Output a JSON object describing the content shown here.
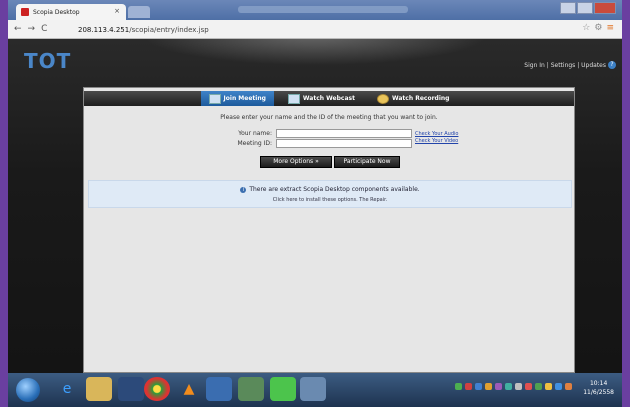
{
  "browser": {
    "tab_title": "Scopia Desktop",
    "tab_close": "×",
    "url_host": "208.113.4.251",
    "url_path": "/scopia/entry/index.jsp",
    "back": "←",
    "forward": "→",
    "reload": "C"
  },
  "page": {
    "logo": "TOT",
    "top_links": "Sign In | Settings | Updates",
    "help_icon": "?",
    "tabs": [
      {
        "label": "Join Meeting",
        "active": true
      },
      {
        "label": "Watch Webcast",
        "active": false
      },
      {
        "label": "Watch Recording",
        "active": false
      }
    ],
    "instruction": "Please enter your name and the ID of the meeting that you want to join.",
    "form": {
      "name_label": "Your name:",
      "name_value": "",
      "meeting_label": "Meeting ID:",
      "meeting_value": "",
      "check_audio": "Check Your Audio",
      "check_video": "Check Your Video"
    },
    "buttons": {
      "more_options": "More Options »",
      "participate": "Participate Now"
    },
    "notice": {
      "line1": "There are extract Scopia Desktop components available.",
      "line2": "Click here to install these options. The Repair."
    }
  },
  "taskbar": {
    "time": "10:14",
    "date": "11/6/2558"
  }
}
